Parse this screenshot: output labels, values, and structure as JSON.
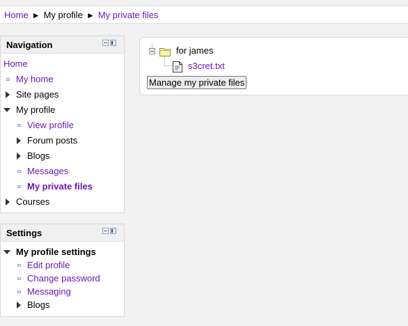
{
  "breadcrumb": {
    "home": "Home",
    "separator": "►",
    "profile": "My profile",
    "current": "My private files"
  },
  "navigation": {
    "title": "Navigation",
    "home": "Home",
    "my_home": "My home",
    "site_pages": "Site pages",
    "my_profile": "My profile",
    "view_profile": "View profile",
    "forum_posts": "Forum posts",
    "blogs": "Blogs",
    "messages": "Messages",
    "my_private_files": "My private files",
    "courses": "Courses"
  },
  "settings": {
    "title": "Settings",
    "my_profile_settings": "My profile settings",
    "edit_profile": "Edit profile",
    "change_password": "Change password",
    "messaging": "Messaging",
    "blogs": "Blogs"
  },
  "files": {
    "folder_name": "for james",
    "file_name": "s3cret.txt",
    "manage_button": "Manage my private files"
  },
  "colors": {
    "link": "#6b18b4",
    "block_header": "#f0f0f0",
    "page_background": "#f2f2f2"
  }
}
